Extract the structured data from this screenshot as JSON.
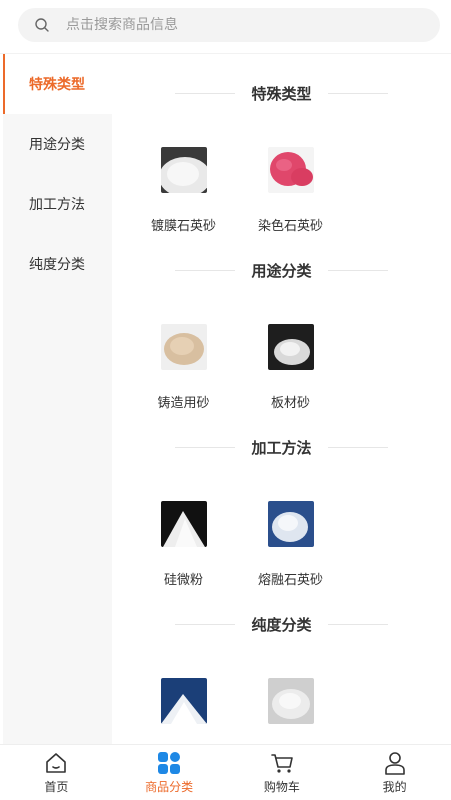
{
  "search": {
    "placeholder": "点击搜索商品信息",
    "icon": "search-icon"
  },
  "sidebar": {
    "items": [
      {
        "label": "特殊类型",
        "active": true
      },
      {
        "label": "用途分类",
        "active": false
      },
      {
        "label": "加工方法",
        "active": false
      },
      {
        "label": "纯度分类",
        "active": false
      }
    ]
  },
  "sections": [
    {
      "title": "特殊类型",
      "products": [
        {
          "name": "镀膜石英砂",
          "image": "white-sand"
        },
        {
          "name": "染色石英砂",
          "image": "pink-sand"
        }
      ]
    },
    {
      "title": "用途分类",
      "products": [
        {
          "name": "铸造用砂",
          "image": "beige-sand"
        },
        {
          "name": "板材砂",
          "image": "dark-sand"
        }
      ]
    },
    {
      "title": "加工方法",
      "products": [
        {
          "name": "硅微粉",
          "image": "white-powder"
        },
        {
          "name": "熔融石英砂",
          "image": "blue-powder"
        }
      ]
    },
    {
      "title": "纯度分类",
      "products": [
        {
          "name": "",
          "image": "blue-white-sand"
        },
        {
          "name": "",
          "image": "gray-white-sand"
        }
      ]
    }
  ],
  "tabbar": {
    "items": [
      {
        "label": "首页",
        "icon": "home-icon",
        "active": false
      },
      {
        "label": "商品分类",
        "icon": "category-icon",
        "active": true
      },
      {
        "label": "购物车",
        "icon": "cart-icon",
        "active": false
      },
      {
        "label": "我的",
        "icon": "user-icon",
        "active": false
      }
    ]
  },
  "colors": {
    "accent": "#ec6a2a",
    "sidebar_bg": "#f7f7f7",
    "search_bg": "#f3f3f3",
    "category_icon": "#1e88e5"
  }
}
